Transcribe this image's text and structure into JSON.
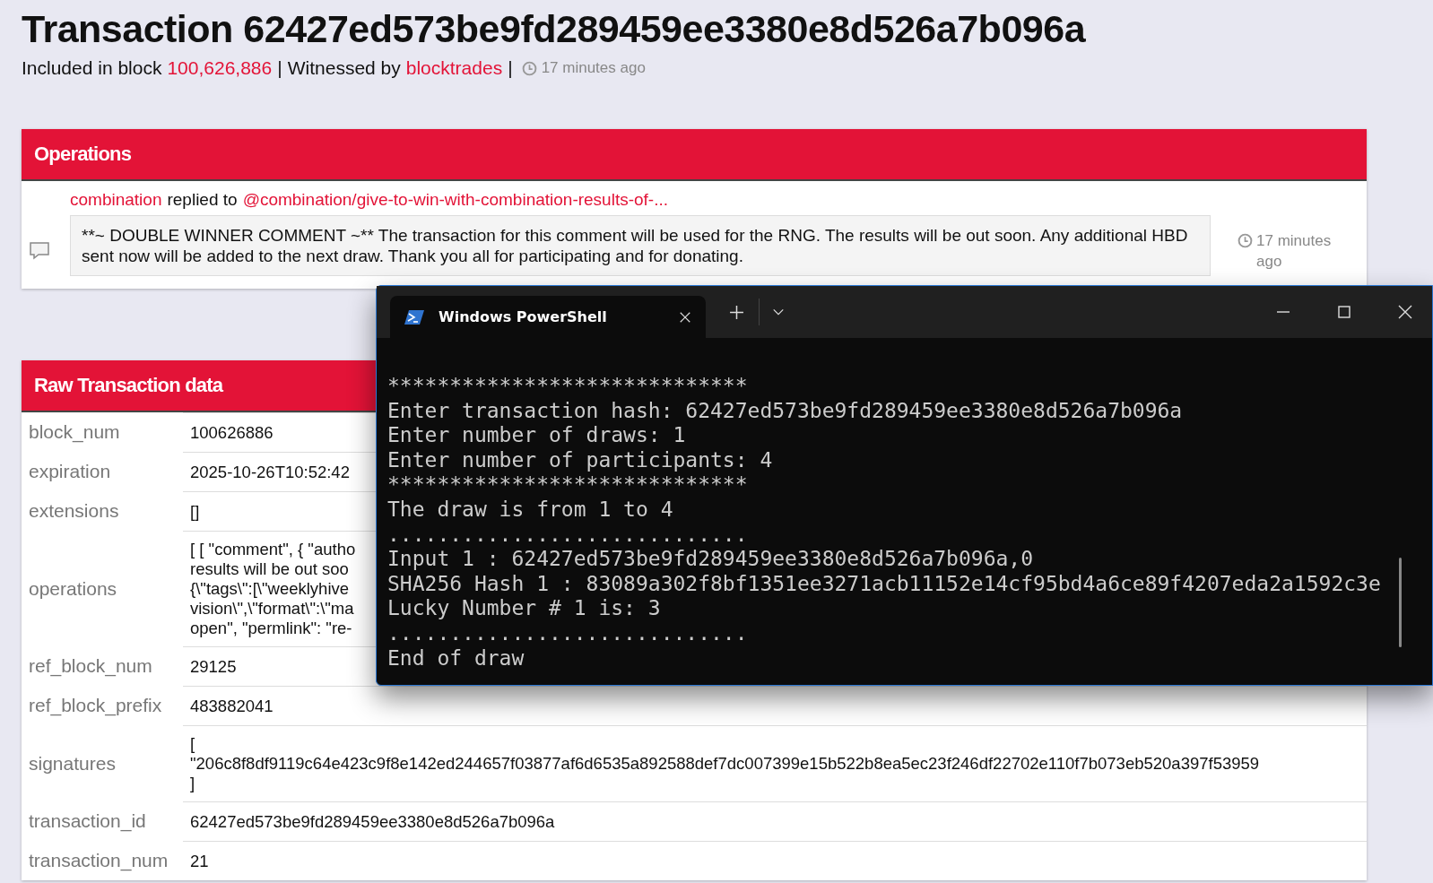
{
  "header": {
    "title": "Transaction 62427ed573be9fd289459ee3380e8d526a7b096a",
    "block_label": "Included in block",
    "block": "100,626,886",
    "separator_1": "|",
    "witness_label": "Witnessed by",
    "witness": "blocktrades",
    "separator_2": "|",
    "time": "17 minutes ago"
  },
  "operations_panel": {
    "title": "Operations",
    "items": [
      {
        "author": "combination",
        "action": "replied to",
        "target": "@combination/give-to-win-with-combination-results-of-...",
        "body": "**~ DOUBLE WINNER COMMENT ~** The transaction for this comment will be used for the RNG. The results will be out soon. Any additional HBD sent now will be added to the next draw. Thank you all for participating and for donating.",
        "time": "17 minutes ago"
      }
    ]
  },
  "raw_panel": {
    "title": "Raw Transaction data",
    "rows": [
      {
        "key": "block_num",
        "lines": [
          "100626886"
        ]
      },
      {
        "key": "expiration",
        "lines": [
          "2025-10-26T10:52:42"
        ]
      },
      {
        "key": "extensions",
        "lines": [
          "[]"
        ]
      },
      {
        "key": "operations",
        "lines": [
          "[ [ \"comment\", { \"autho",
          "results will be out soo",
          "{\\\"tags\\\":[\\\"weeklyhive",
          "vision\\\",\\\"format\\\":\\\"ma",
          "open\", \"permlink\": \"re-"
        ]
      },
      {
        "key": "ref_block_num",
        "lines": [
          "29125"
        ]
      },
      {
        "key": "ref_block_prefix",
        "lines": [
          "483882041"
        ]
      },
      {
        "key": "signatures",
        "lines": [
          "[",
          "\"206c8f8df9119c64e423c9f8e142ed244657f03877af6d6535a892588def7dc007399e15b522b8ea5ec23f246df22702e110f7b073eb520a397f53959",
          "]"
        ]
      },
      {
        "key": "transaction_id",
        "lines": [
          "62427ed573be9fd289459ee3380e8d526a7b096a"
        ]
      },
      {
        "key": "transaction_num",
        "lines": [
          "21"
        ]
      }
    ]
  },
  "terminal": {
    "tab_title": "Windows PowerShell",
    "lines": [
      "*****************************",
      "Enter transaction hash: 62427ed573be9fd289459ee3380e8d526a7b096a",
      "Enter number of draws: 1",
      "Enter number of participants: 4",
      "*****************************",
      "The draw is from 1 to 4",
      ".............................",
      "Input 1 : 62427ed573be9fd289459ee3380e8d526a7b096a,0",
      "SHA256 Hash 1 : 83089a302f8bf1351ee3271acb11152e14cf95bd4a6ce89f4207eda2a1592c3e",
      "Lucky Number # 1 is: 3",
      ".............................",
      "End of draw"
    ]
  }
}
